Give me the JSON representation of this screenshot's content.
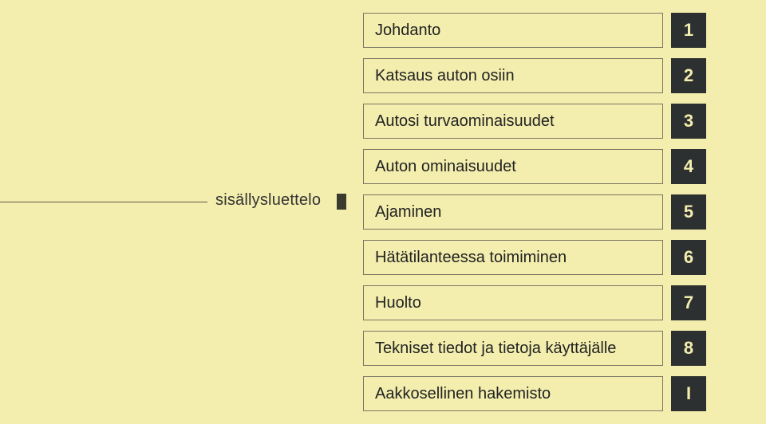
{
  "sidebar_label": "sisällysluettelo",
  "toc": [
    {
      "label": "Johdanto",
      "num": "1"
    },
    {
      "label": "Katsaus auton osiin",
      "num": "2"
    },
    {
      "label": "Autosi turvaominaisuudet",
      "num": "3"
    },
    {
      "label": "Auton ominaisuudet",
      "num": "4"
    },
    {
      "label": "Ajaminen",
      "num": "5"
    },
    {
      "label": "Hätätilanteessa toimiminen",
      "num": "6"
    },
    {
      "label": "Huolto",
      "num": "7"
    },
    {
      "label": "Tekniset tiedot ja tietoja käyttäjälle",
      "num": "8"
    },
    {
      "label": "Aakkosellinen hakemisto",
      "num": "I"
    }
  ]
}
